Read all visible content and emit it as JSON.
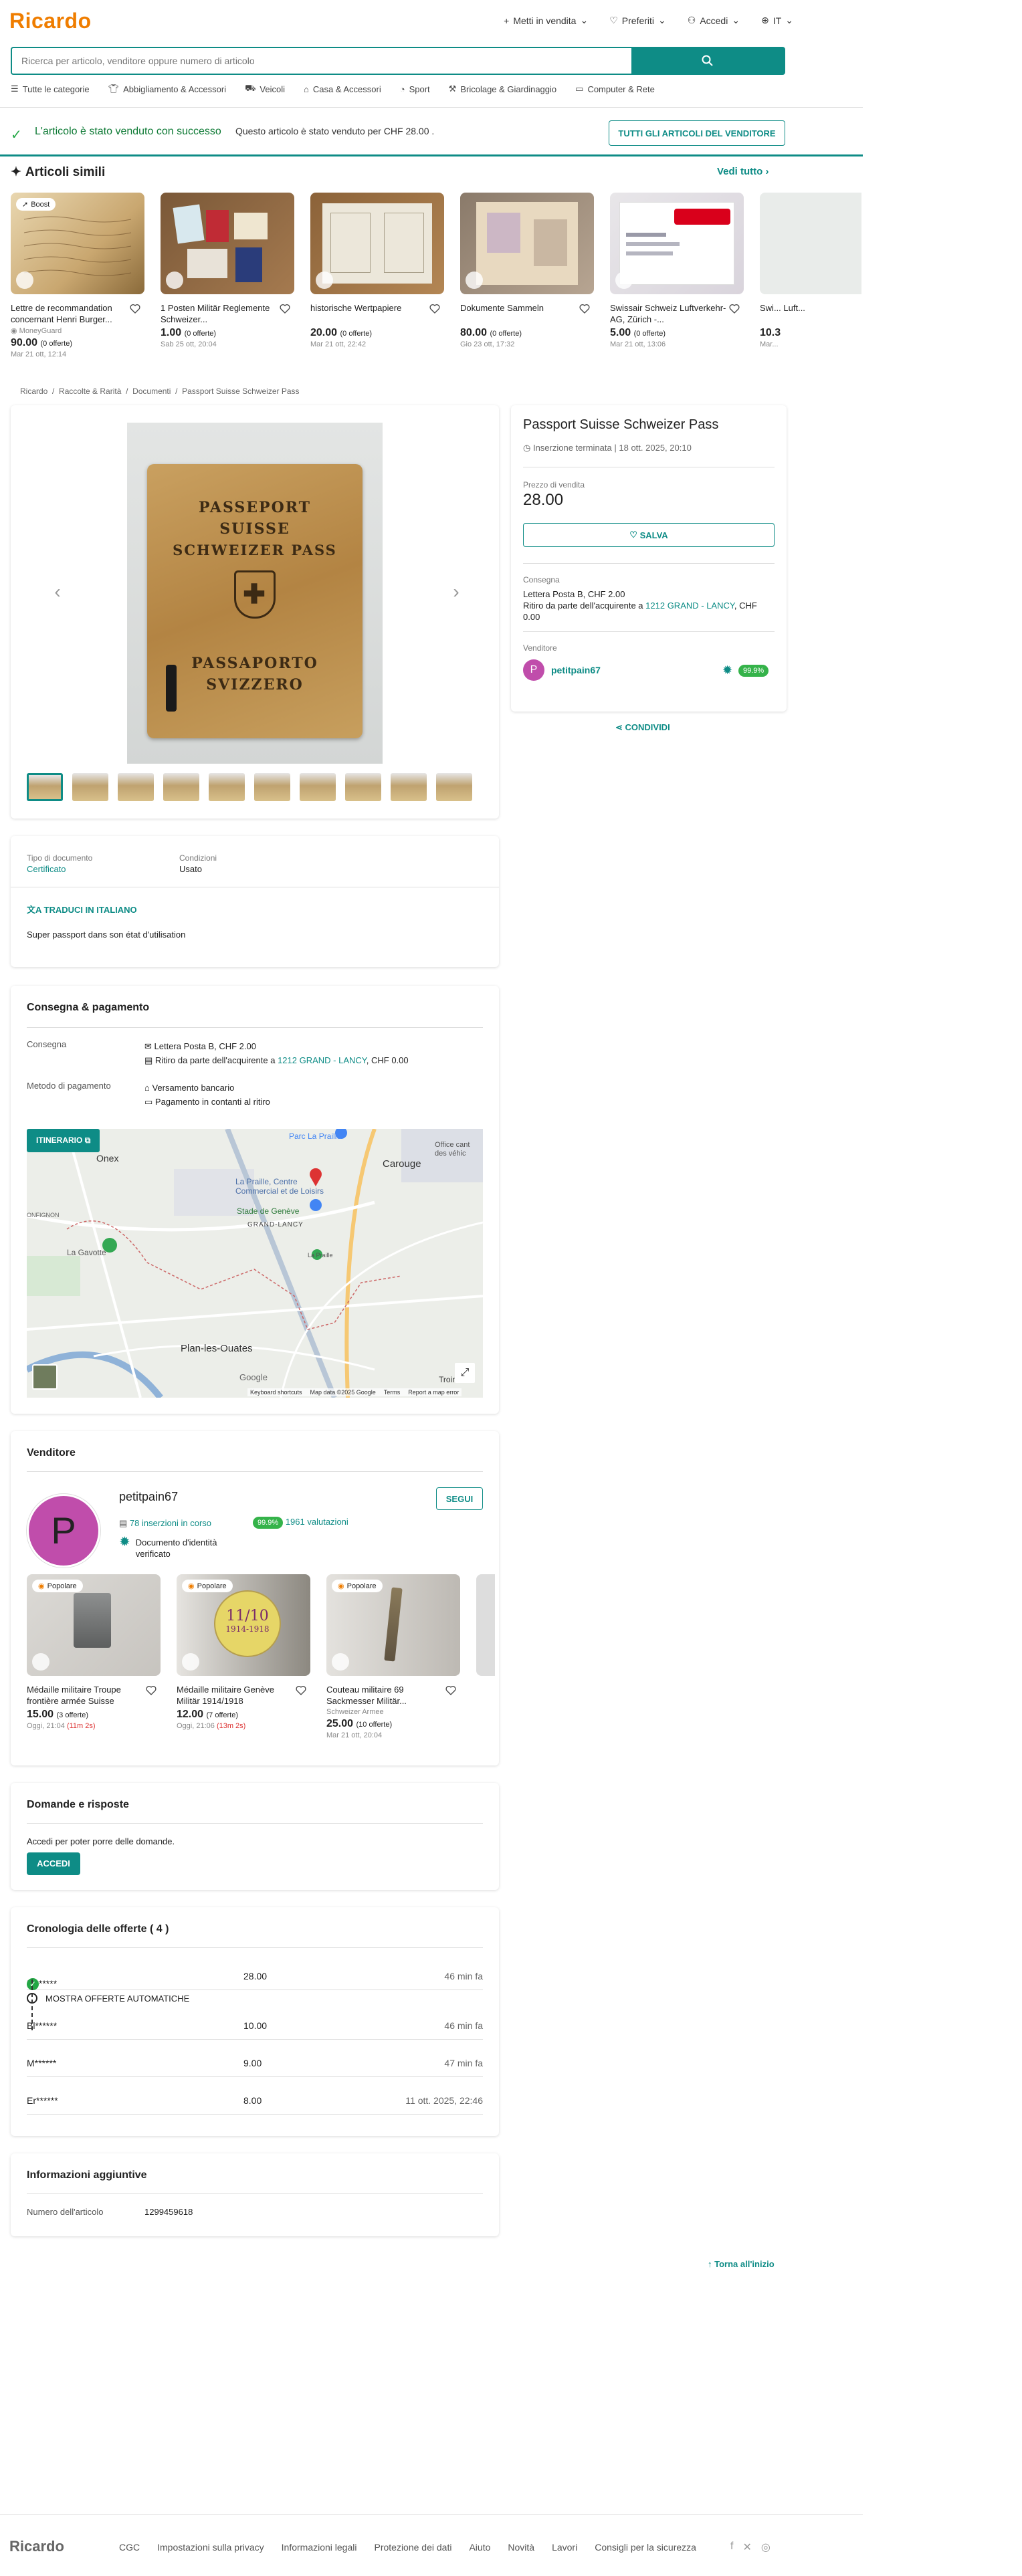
{
  "header": {
    "logo": "Ricardo",
    "nav": [
      "Metti in vendita",
      "Preferiti",
      "Accedi",
      "IT"
    ]
  },
  "search": {
    "placeholder": "Ricerca per articolo, venditore oppure numero di articolo"
  },
  "categories": [
    "Tutte le categorie",
    "Abbigliamento & Accessori",
    "Veicoli",
    "Casa & Accessori",
    "Sport",
    "Bricolage & Giardinaggio",
    "Computer & Rete"
  ],
  "banner": {
    "title": "L'articolo è stato venduto con successo",
    "text": "Questo articolo è stato venduto per CHF 28.00 .",
    "button": "TUTTI GLI ARTICOLI DEL VENDITORE"
  },
  "similar": {
    "title": "Articoli simili",
    "see_all": "Vedi tutto",
    "items": [
      {
        "badge": "Boost",
        "title": "Lettre de recommandation concernant Henri Burger...",
        "seller": "MoneyGuard",
        "price": "90.00",
        "offers": "(0 offerte)",
        "date": "Mar 21 ott, 12:14"
      },
      {
        "title": "1 Posten Militär Reglemente Schweizer...",
        "price": "1.00",
        "offers": "(0 offerte)",
        "date": "Sab 25 ott, 20:04"
      },
      {
        "title": "historische Wertpapiere",
        "price": "20.00",
        "offers": "(0 offerte)",
        "date": "Mar 21 ott, 22:42"
      },
      {
        "title": "Dokumente Sammeln",
        "price": "80.00",
        "offers": "(0 offerte)",
        "date": "Gio 23 ott, 17:32"
      },
      {
        "title": "Swissair Schweiz Luftverkehr-AG, Zürich -...",
        "price": "5.00",
        "offers": "(0 offerte)",
        "date": "Mar 21 ott, 13:06"
      },
      {
        "title": "Swi... Luft...",
        "price": "10.3",
        "offers": "",
        "date": "Mar..."
      }
    ]
  },
  "breadcrumb": [
    "Ricardo",
    "Raccolte & Rarità",
    "Documenti",
    "Passport Suisse Schweizer Pass"
  ],
  "product": {
    "title": "Passport Suisse Schweizer Pass",
    "ended": "Inserzione terminata |",
    "ended_date": "18 ott. 2025, 20:10",
    "price_label": "Prezzo di vendita",
    "price": "28.00",
    "save": "SALVA",
    "delivery_label": "Consegna",
    "delivery_1": "Lettera Posta B, CHF 2.00",
    "delivery_2a": "Ritiro da parte dell'acquirente a ",
    "delivery_2link": "1212 GRAND - LANCY",
    "delivery_2b": ", CHF 0.00",
    "seller_label": "Venditore",
    "seller": "petitpain67",
    "seller_rating": "99.9%",
    "share": "CONDIVIDI",
    "image_text": [
      "PASSEPORT",
      "SUISSE",
      "SCHWEIZER PASS",
      "PASSAPORTO",
      "SVIZZERO"
    ]
  },
  "details": {
    "doc_type_label": "Tipo di documento",
    "doc_type": "Certificato",
    "condition_label": "Condizioni",
    "condition": "Usato",
    "translate": "TRADUCI IN ITALIANO",
    "description": "Super passport dans son état d'utilisation"
  },
  "shipping": {
    "title": "Consegna & pagamento",
    "delivery_label": "Consegna",
    "delivery_1": "Lettera Posta B, CHF 2.00",
    "delivery_2a": "Ritiro da parte dell'acquirente a ",
    "delivery_2link": "1212 GRAND - LANCY",
    "delivery_2b": ", CHF 0.00",
    "payment_label": "Metodo di pagamento",
    "payment_1": "Versamento bancario",
    "payment_2": "Pagamento in contanti al ritiro",
    "itinerary": "ITINERARIO",
    "map_labels": [
      "Onex",
      "Carouge",
      "Parc La Praille",
      "La Praille, Centre Commercial et de Loisirs",
      "Stade de Genève",
      "GRAND-LANCY",
      "La Gavotte",
      "Plan-les-Ouates",
      "Troinex",
      "Office cant des véhic",
      "ONFIGNON",
      "La Praille"
    ],
    "map_footer": [
      "Keyboard shortcuts",
      "Map data ©2025 Google",
      "Terms",
      "Report a map error"
    ],
    "google": "Google"
  },
  "seller_box": {
    "title": "Venditore",
    "avatar": "P",
    "name": "petitpain67",
    "follow": "SEGUI",
    "listings": "78 inserzioni in corso",
    "rating": "99.9%",
    "reviews": "1961 valutazioni",
    "verified": "Documento d'identità verificato",
    "items": [
      {
        "badge": "Popolare",
        "title": "Médaille militaire Troupe frontière armée Suisse",
        "price": "15.00",
        "offers": "(3 offerte)",
        "date": "Oggi, 21:04",
        "left": "(11m 2s)"
      },
      {
        "badge": "Popolare",
        "title": "Médaille militaire Genève Militär 1914/1918",
        "price": "12.00",
        "offers": "(7 offerte)",
        "date": "Oggi, 21:06",
        "left": "(13m 2s)",
        "img_text": [
          "11/10",
          "1914-1918"
        ]
      },
      {
        "badge": "Popolare",
        "title": "Couteau militaire 69 Sackmesser Militär...",
        "sub": "Schweizer Armee",
        "price": "25.00",
        "offers": "(10 offerte)",
        "date": "Mar 21 ott, 20:04"
      }
    ]
  },
  "qa": {
    "title": "Domande e risposte",
    "text": "Accedi per poter porre delle domande.",
    "button": "ACCEDI"
  },
  "history": {
    "title": "Cronologia delle offerte ( 4 )",
    "auto": "MOSTRA OFFERTE AUTOMATICHE",
    "rows": [
      {
        "user": "Bl******",
        "amount": "28.00",
        "time": "46 min fa"
      },
      {
        "user": "Bl******",
        "amount": "10.00",
        "time": "46 min fa"
      },
      {
        "user": "M******",
        "amount": "9.00",
        "time": "47 min fa"
      },
      {
        "user": "Er******",
        "amount": "8.00",
        "time": "11 ott. 2025, 22:46"
      }
    ]
  },
  "info": {
    "title": "Informazioni aggiuntive",
    "label": "Numero dell'articolo",
    "value": "1299459618"
  },
  "back_top": "Torna all'inizio",
  "footer": {
    "logo": "Ricardo",
    "links": [
      "CGC",
      "Impostazioni sulla privacy",
      "Informazioni legali",
      "Protezione dei dati",
      "Aiuto",
      "Novità",
      "Lavori",
      "Consigli per la sicurezza"
    ]
  },
  "colors": {
    "accent": "#0e8c86",
    "brand": "#ef7d00",
    "success": "#23a745"
  }
}
